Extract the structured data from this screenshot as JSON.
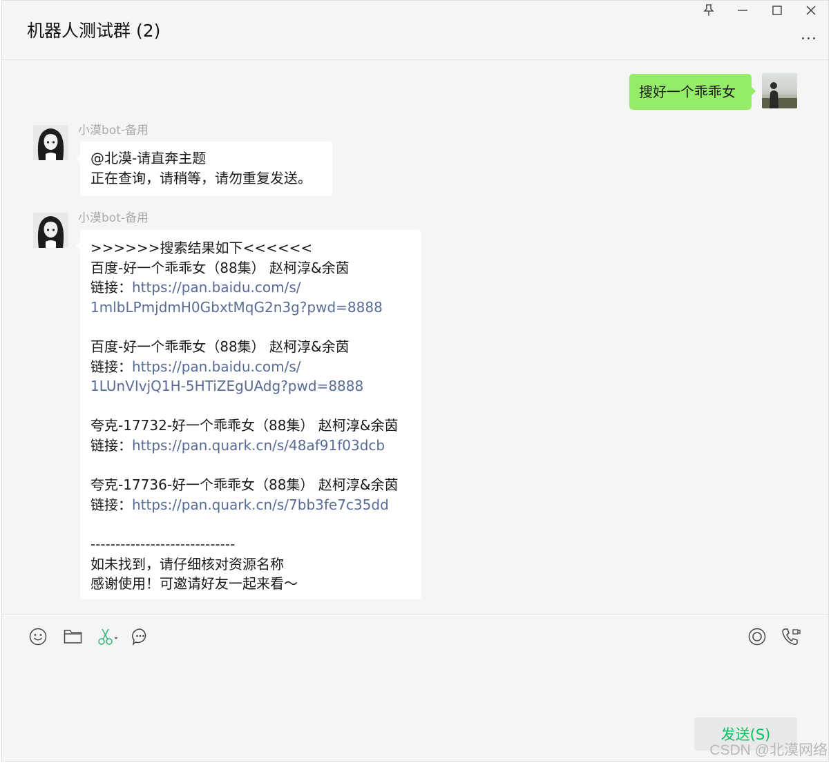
{
  "header": {
    "title": "机器人测试群 (2)",
    "more": "..."
  },
  "messages": {
    "m1": {
      "text": "搜好一个乖乖女"
    },
    "m2": {
      "sender": "小漠bot-备用",
      "lines": [
        "@北漠-请直奔主题",
        "正在查询，请稍等，请勿重复发送。"
      ]
    },
    "m3": {
      "sender": "小漠bot-备用",
      "l1": ">>>>>>搜索结果如下<<<<<<",
      "l2": "百度-好一个乖乖女（88集） 赵柯淳&余茵",
      "l3_prefix": "链接：",
      "l3_link": "https://pan.baidu.com/s/",
      "l4_link": "1mlbLPmjdmH0GbxtMqG2n3g?pwd=8888",
      "l6": "百度-好一个乖乖女（88集） 赵柯淳&余茵",
      "l7_prefix": "链接：",
      "l7_link": "https://pan.baidu.com/s/",
      "l8_link": "1LUnVIvjQ1H-5HTiZEgUAdg?pwd=8888",
      "l10": "夸克-17732-好一个乖乖女（88集） 赵柯淳&余茵",
      "l11_prefix": "链接：",
      "l11_link": "https://pan.quark.cn/s/48af91f03dcb",
      "l13": "夸克-17736-好一个乖乖女（88集） 赵柯淳&余茵",
      "l14_prefix": "链接：",
      "l14_link": "https://pan.quark.cn/s/7bb3fe7c35dd",
      "l16": "-----------------------------",
      "l17": "如未找到，请仔细核对资源名称",
      "l18": "感谢使用！可邀请好友一起来看～"
    }
  },
  "toolbar": {
    "icons": [
      "emoji-icon",
      "folder-icon",
      "scissors-icon",
      "chat-history-icon",
      "live-icon",
      "call-icon"
    ]
  },
  "composer": {
    "send_label": "发送(S)"
  },
  "watermark": "CSDN @北漠网络",
  "colors": {
    "my_bubble": "#95ec69",
    "link": "#576b95",
    "send_text": "#07c160"
  }
}
